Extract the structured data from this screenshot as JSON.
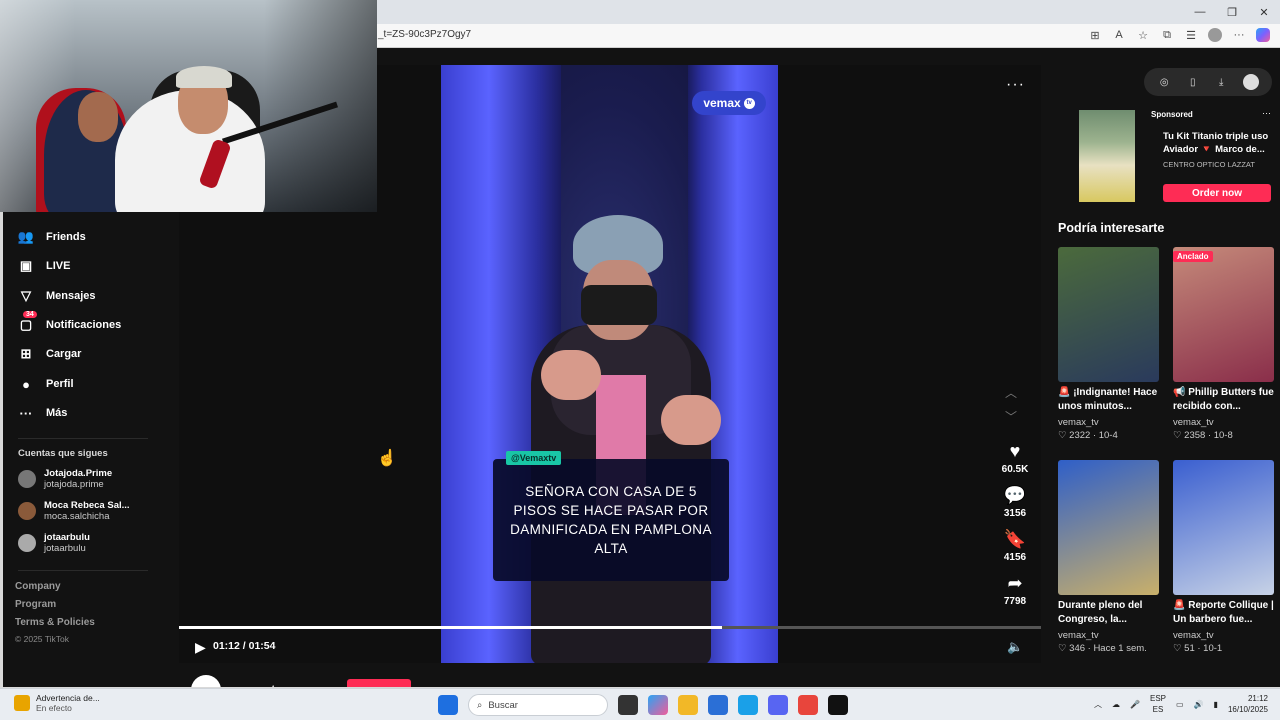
{
  "browser": {
    "url": "_t=ZS-90c3Pz7Ogy7",
    "window_controls": [
      "—",
      "❐",
      "✕"
    ]
  },
  "sidebar": {
    "items": [
      {
        "label": "Friends",
        "icon": "friends-icon",
        "glyph": "👥"
      },
      {
        "label": "LIVE",
        "icon": "live-icon",
        "glyph": "▣"
      },
      {
        "label": "Mensajes",
        "icon": "messages-icon",
        "glyph": "▽"
      },
      {
        "label": "Notificaciones",
        "icon": "notifications-icon",
        "glyph": "▢",
        "badge": "34"
      },
      {
        "label": "Cargar",
        "icon": "upload-icon",
        "glyph": "⊞"
      },
      {
        "label": "Perfil",
        "icon": "profile-icon",
        "glyph": "●"
      },
      {
        "label": "Más",
        "icon": "more-icon",
        "glyph": "···"
      }
    ],
    "following_title": "Cuentas que sigues",
    "following": [
      {
        "name": "Jotajoda.Prime",
        "handle": "jotajoda.prime"
      },
      {
        "name": "Moca Rebeca Sal...",
        "handle": "moca.salchicha"
      },
      {
        "name": "jotaarbulu",
        "handle": "jotaarbulu"
      }
    ],
    "footer": [
      "Company",
      "Program",
      "Terms & Policies"
    ],
    "copyright": "© 2025 TikTok"
  },
  "video": {
    "watermark": "vemax",
    "watermark_tv": "tv",
    "tag": "@Vemaxtv",
    "caption": "SEÑORA CON CASA DE 5 PISOS SE HACE PASAR POR DAMNIFICADA EN PAMPLONA ALTA",
    "time": "01:12 / 01:54",
    "progress": 0.63,
    "author": "vemax_tv",
    "actions": [
      {
        "icon": "heart-icon",
        "glyph": "♥",
        "count": "60.5K"
      },
      {
        "icon": "comment-icon",
        "glyph": "💬",
        "count": "3156"
      },
      {
        "icon": "bookmark-icon",
        "glyph": "🔖",
        "count": "4156"
      },
      {
        "icon": "share-icon",
        "glyph": "➦",
        "count": "7798"
      }
    ]
  },
  "ad": {
    "sponsored": "Sponsored",
    "title": "Tu Kit Titanio triple uso Aviador 🔻 Marco de...",
    "brand": "CENTRO OPTICO LAZZAT",
    "cta": "Order now"
  },
  "interest": {
    "title": "Podría interesarte",
    "cards": [
      {
        "title": "🚨 ¡Indignante! Hace unos minutos...",
        "author": "vemax_tv",
        "stats": "♡ 2322 · 10-4",
        "pinned": "",
        "colors": [
          "#4b6a3c",
          "#2a3a5c"
        ]
      },
      {
        "title": "📢 Phillip Butters fue recibido con...",
        "author": "vemax_tv",
        "stats": "♡ 2358 · 10-8",
        "pinned": "Anclado",
        "colors": [
          "#c58a7a",
          "#8a2e4a"
        ]
      },
      {
        "title": "Durante pleno del Congreso, la...",
        "author": "vemax_tv",
        "stats": "♡ 346 · Hace 1 sem.",
        "pinned": "",
        "colors": [
          "#2f5fc8",
          "#c9b06a"
        ]
      },
      {
        "title": "🚨 Reporte Collique | Un barbero fue...",
        "author": "vemax_tv",
        "stats": "♡ 51 · 10-1",
        "pinned": "",
        "colors": [
          "#3a5fd0",
          "#c7d2e6"
        ]
      }
    ]
  },
  "taskbar": {
    "warning_title": "Advertencia de...",
    "warning_sub": "En efecto",
    "search": "Buscar",
    "lang": "ESP",
    "lang2": "ES",
    "time": "21:12",
    "date": "16/10/2025"
  }
}
